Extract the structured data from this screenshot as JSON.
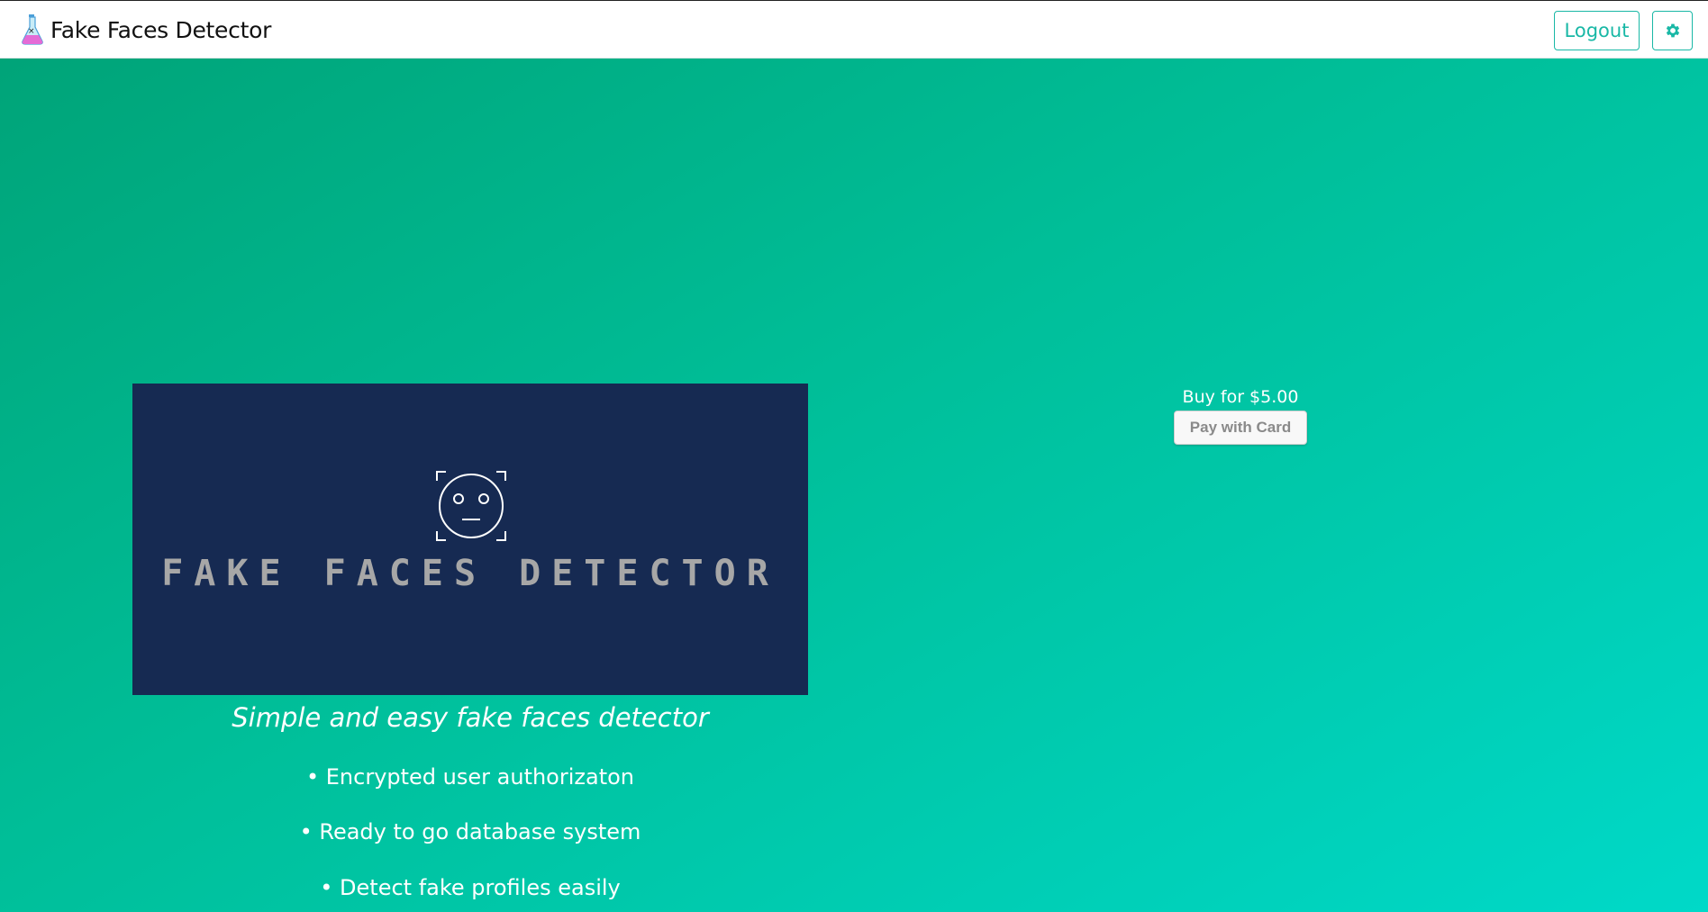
{
  "navbar": {
    "brand": "Fake Faces Detector",
    "brand_icon": "flask-icon",
    "logout_label": "Logout",
    "settings_icon": "gear-icon"
  },
  "hero": {
    "logo_icon": "face-scan-icon",
    "logo_text": "FAKE FACES DETECTOR",
    "tagline": "Simple and easy fake faces detector",
    "features": [
      "• Encrypted user authorizaton",
      "• Ready to go database system",
      "• Detect fake profiles easily"
    ]
  },
  "purchase": {
    "price_label": "Buy for $5.00",
    "pay_button_label": "Pay with Card"
  },
  "colors": {
    "accent": "#19b8a6",
    "hero_card": "#162a52",
    "gradient_start": "#00a276",
    "gradient_end": "#00d9c8"
  }
}
